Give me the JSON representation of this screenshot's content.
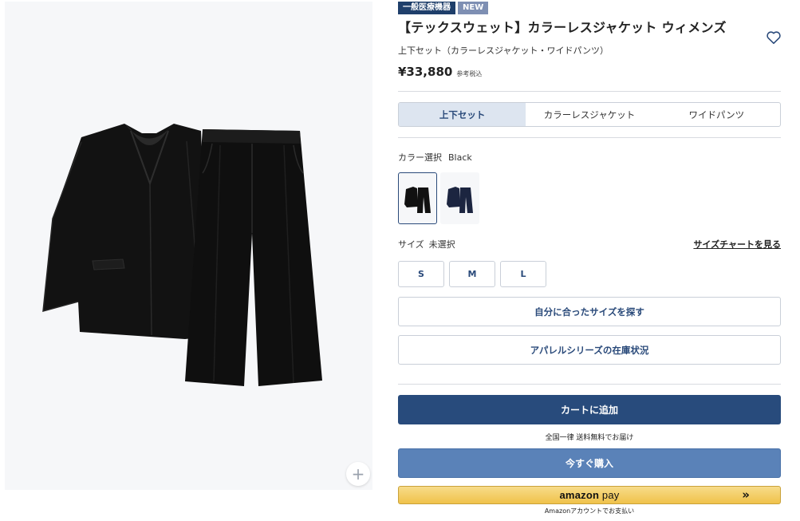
{
  "badges": {
    "medical": "一般医療機器",
    "new": "NEW"
  },
  "product": {
    "title": "【テックスウェット】カラーレスジャケット ウィメンズ",
    "subtitle": "上下セット（カラーレスジャケット・ワイドパンツ）",
    "price": "¥33,880",
    "price_note": "参考税込"
  },
  "tabs": [
    {
      "label": "上下セット",
      "active": true
    },
    {
      "label": "カラーレスジャケット",
      "active": false
    },
    {
      "label": "ワイドパンツ",
      "active": false
    }
  ],
  "color": {
    "label": "カラー選択",
    "selected": "Black",
    "swatches": [
      {
        "name": "Black",
        "hex": "#111111",
        "selected": true
      },
      {
        "name": "Navy",
        "hex": "#1c2540",
        "selected": false
      }
    ]
  },
  "size": {
    "label": "サイズ",
    "selected": "未選択",
    "chart_link": "サイズチャートを見る",
    "options": [
      "S",
      "M",
      "L"
    ]
  },
  "buttons": {
    "find_size": "自分に合ったサイズを探す",
    "stock": "アパレルシリーズの在庫状況",
    "cart": "カートに追加",
    "buy_now": "今すぐ購入"
  },
  "shipping_note": "全国一律 送料無料でお届け",
  "amazon": {
    "logo_bold": "amazon",
    "logo_text": " pay",
    "arrow": "»",
    "note": "Amazonアカウントでお支払い"
  },
  "zoom_label": "+",
  "colors": {
    "brand": "#284b7c",
    "buy": "#5a82b8",
    "tab_active": "#dde5f0",
    "amazon": "#f0c24a"
  }
}
